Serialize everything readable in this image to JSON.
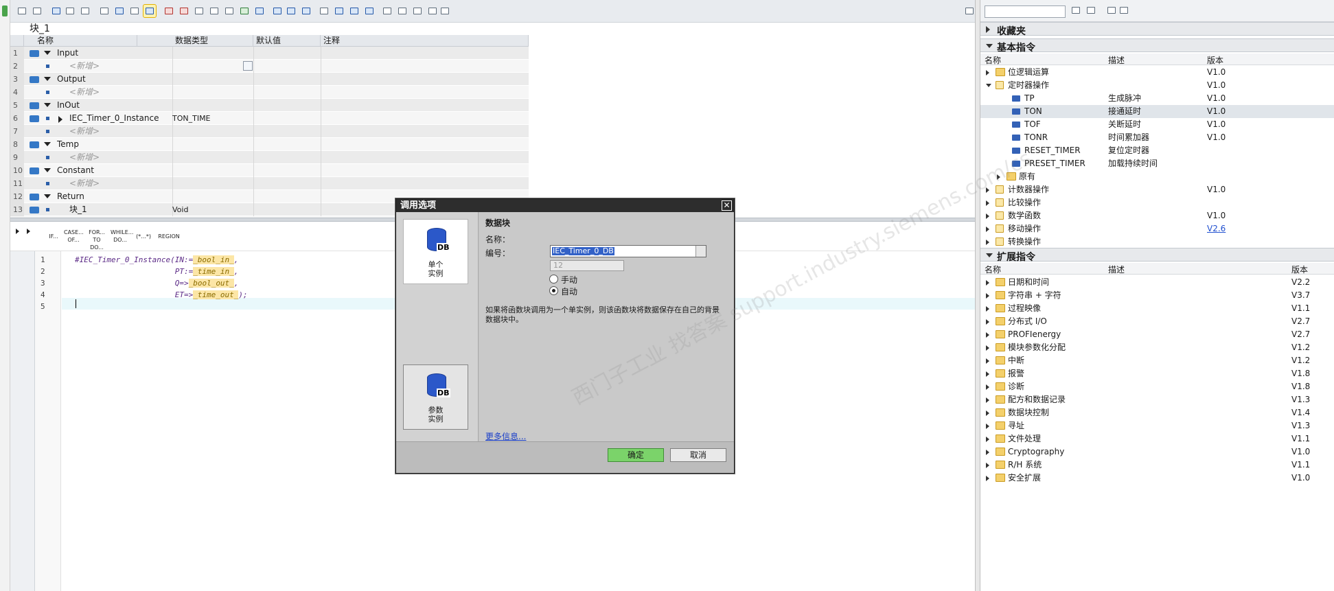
{
  "block_title": "块_1",
  "interface": {
    "columns": [
      "名称",
      "数据类型",
      "默认值",
      "注释"
    ],
    "rows": [
      {
        "n": "1",
        "kind": "section",
        "name": "Input",
        "type": ""
      },
      {
        "n": "2",
        "kind": "placeholder",
        "name": "<新增>",
        "type": ""
      },
      {
        "n": "3",
        "kind": "section",
        "name": "Output",
        "type": ""
      },
      {
        "n": "4",
        "kind": "placeholder",
        "name": "<新增>",
        "type": ""
      },
      {
        "n": "5",
        "kind": "section",
        "name": "InOut",
        "type": ""
      },
      {
        "n": "6",
        "kind": "item",
        "name": "IEC_Timer_0_Instance",
        "type": "TON_TIME"
      },
      {
        "n": "7",
        "kind": "placeholder",
        "name": "<新增>",
        "type": ""
      },
      {
        "n": "8",
        "kind": "section",
        "name": "Temp",
        "type": ""
      },
      {
        "n": "9",
        "kind": "placeholder",
        "name": "<新增>",
        "type": ""
      },
      {
        "n": "10",
        "kind": "section",
        "name": "Constant",
        "type": ""
      },
      {
        "n": "11",
        "kind": "placeholder",
        "name": "<新增>",
        "type": ""
      },
      {
        "n": "12",
        "kind": "section",
        "name": "Return",
        "type": ""
      },
      {
        "n": "13",
        "kind": "return",
        "name": "块_1",
        "type": "Void"
      }
    ]
  },
  "scl_toolbar": [
    "IF...",
    "CASE... OF...",
    "FOR... TO DO...",
    "WHILE... DO...",
    "(*...*)",
    "REGION"
  ],
  "code_lines": [
    {
      "n": "1",
      "segs": [
        {
          "t": "#IEC_Timer_0_Instance(IN:="
        },
        {
          "t": "_bool_in_",
          "h": true
        },
        {
          "t": ","
        }
      ]
    },
    {
      "n": "2",
      "segs": [
        {
          "t": "                      PT:="
        },
        {
          "t": "_time_in_",
          "h": true
        },
        {
          "t": ","
        }
      ]
    },
    {
      "n": "3",
      "segs": [
        {
          "t": "                      Q=>"
        },
        {
          "t": "_bool_out_",
          "h": true
        },
        {
          "t": ","
        }
      ]
    },
    {
      "n": "4",
      "segs": [
        {
          "t": "                      ET=>"
        },
        {
          "t": "_time_out_",
          "h": true
        },
        {
          "t": ");"
        }
      ]
    },
    {
      "n": "5",
      "segs": []
    }
  ],
  "right_panel": {
    "favorites": "收藏夹",
    "basic": {
      "title": "基本指令",
      "columns": [
        "名称",
        "描述",
        "版本"
      ],
      "items": [
        {
          "indent": 0,
          "exp": "right",
          "icon": "folder",
          "name": "位逻辑运算",
          "desc": "",
          "ver": "V1.0"
        },
        {
          "indent": 0,
          "exp": "down",
          "icon": "timer",
          "name": "定时器操作",
          "desc": "",
          "ver": "V1.0"
        },
        {
          "indent": 1,
          "exp": "",
          "icon": "block",
          "name": "TP",
          "desc": "生成脉冲",
          "ver": "V1.0"
        },
        {
          "indent": 1,
          "exp": "",
          "icon": "block",
          "name": "TON",
          "desc": "接通延时",
          "ver": "V1.0",
          "sel": true
        },
        {
          "indent": 1,
          "exp": "",
          "icon": "block",
          "name": "TOF",
          "desc": "关断延时",
          "ver": "V1.0"
        },
        {
          "indent": 1,
          "exp": "",
          "icon": "block",
          "name": "TONR",
          "desc": "时间累加器",
          "ver": "V1.0"
        },
        {
          "indent": 1,
          "exp": "",
          "icon": "block",
          "name": "RESET_TIMER",
          "desc": "复位定时器",
          "ver": ""
        },
        {
          "indent": 1,
          "exp": "",
          "icon": "block",
          "name": "PRESET_TIMER",
          "desc": "加载持续时间",
          "ver": ""
        },
        {
          "indent": 1,
          "exp": "right",
          "icon": "folder",
          "name": "原有",
          "desc": "",
          "ver": ""
        },
        {
          "indent": 0,
          "exp": "right",
          "icon": "counter",
          "name": "计数器操作",
          "desc": "",
          "ver": "V1.0"
        },
        {
          "indent": 0,
          "exp": "right",
          "icon": "compare",
          "name": "比较操作",
          "desc": "",
          "ver": ""
        },
        {
          "indent": 0,
          "exp": "right",
          "icon": "math",
          "name": "数学函数",
          "desc": "",
          "ver": "V1.0"
        },
        {
          "indent": 0,
          "exp": "right",
          "icon": "move",
          "name": "移动操作",
          "desc": "",
          "ver": "V2.6",
          "link": true
        },
        {
          "indent": 0,
          "exp": "right",
          "icon": "conv",
          "name": "转换操作",
          "desc": "",
          "ver": ""
        }
      ]
    },
    "extended": {
      "title": "扩展指令",
      "columns": [
        "名称",
        "描述",
        "版本"
      ],
      "items": [
        {
          "name": "日期和时间",
          "ver": "V2.2"
        },
        {
          "name": "字符串 + 字符",
          "ver": "V3.7"
        },
        {
          "name": "过程映像",
          "ver": "V1.1"
        },
        {
          "name": "分布式 I/O",
          "ver": "V2.7"
        },
        {
          "name": "PROFIenergy",
          "ver": "V2.7"
        },
        {
          "name": "模块参数化分配",
          "ver": "V1.2"
        },
        {
          "name": "中断",
          "ver": "V1.2"
        },
        {
          "name": "报警",
          "ver": "V1.8"
        },
        {
          "name": "诊断",
          "ver": "V1.8"
        },
        {
          "name": "配方和数据记录",
          "ver": "V1.3"
        },
        {
          "name": "数据块控制",
          "ver": "V1.4"
        },
        {
          "name": "寻址",
          "ver": "V1.3"
        },
        {
          "name": "文件处理",
          "ver": "V1.1"
        },
        {
          "name": "Cryptography",
          "ver": "V1.0"
        },
        {
          "name": "R/H 系统",
          "ver": "V1.1"
        },
        {
          "name": "安全扩展",
          "ver": "V1.0"
        }
      ]
    }
  },
  "dialog": {
    "title": "调用选项",
    "single_label": "单个\n实例",
    "multi_label": "参数\n实例",
    "section": "数据块",
    "name_label": "名称：",
    "name_value": "IEC_Timer_0_DB",
    "number_label": "编号：",
    "number_value": "12",
    "manual": "手动",
    "auto": "自动",
    "note": "如果将函数块调用为一个单实例，则该函数块将数据保存在自己的背景数据块中。",
    "more": "更多信息...",
    "ok": "确定",
    "cancel": "取消"
  },
  "watermark": "西门子工业 找答案 support.industry.siemens.com/cs"
}
